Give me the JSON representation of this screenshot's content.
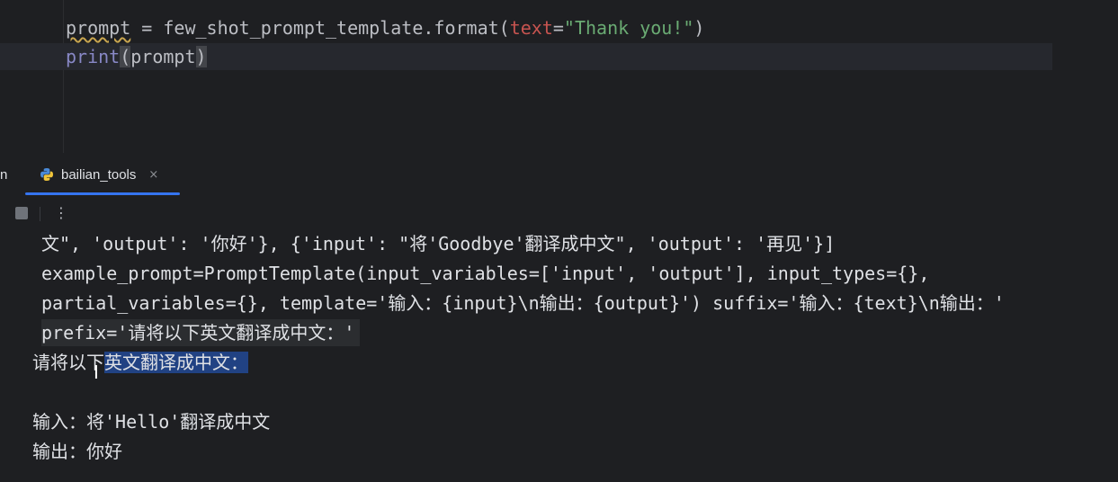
{
  "editor": {
    "line1": {
      "var": "prompt",
      "op": " = ",
      "call": "few_shot_prompt_template.format(",
      "param": "text",
      "eq": "=",
      "str": "\"Thank you!\"",
      "close": ")"
    },
    "line2": {
      "builtin": "print",
      "open": "(",
      "arg": "prompt",
      "close": ")"
    }
  },
  "tool_window": {
    "partial_tab_label": "n",
    "tab": {
      "label": "bailian_tools",
      "icon": "python-icon",
      "close_glyph": "×"
    },
    "toolbar": {
      "stop_icon": "stop-icon",
      "more_glyph": "⋮"
    }
  },
  "output": {
    "line1": "文\", 'output': '你好'}, {'input': \"将'Goodbye'翻译成中文\", 'output': '再见'}]",
    "line2": "example_prompt=PromptTemplate(input_variables=['input', 'output'], input_types={},",
    "line3": "partial_variables={}, template='输入：{input}\\n输出：{output}') suffix='输入：{text}\\n输出：'",
    "line4": "prefix='请将以下英文翻译成中文：'",
    "line5_plain": "请将以下",
    "line5_selected": "英文翻译成中文：",
    "line6": "输入：将'Hello'翻译成中文",
    "line7": "输出：你好"
  },
  "colors": {
    "background": "#1e1f22",
    "accent": "#3574f0",
    "string": "#6aab73",
    "parameter": "#c75450",
    "builtin": "#8888c6",
    "selection": "#214283"
  }
}
